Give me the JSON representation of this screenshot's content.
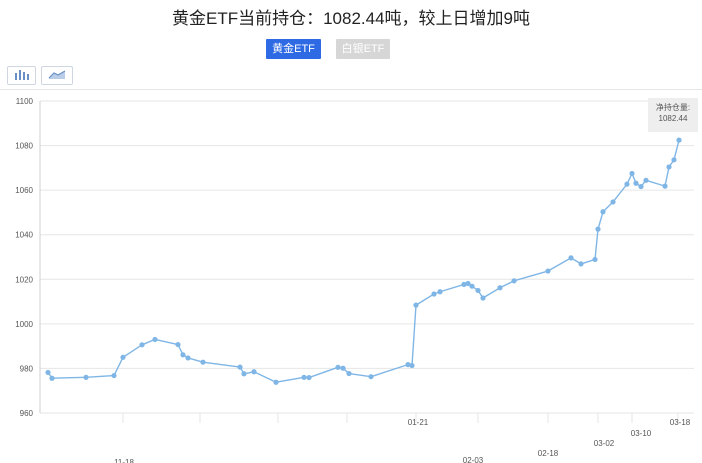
{
  "header": {
    "title": "黄金ETF当前持仓：1082.44吨，较上日增加9吨"
  },
  "tabs": [
    {
      "label": "黄金ETF",
      "active": true,
      "color": "#2d6ae3"
    },
    {
      "label": "白银ETF",
      "active": false,
      "color": "#d6d6d6"
    }
  ],
  "toolbar": {
    "bar_icon": "bar-chart-icon",
    "line_icon": "line-chart-icon"
  },
  "tooltip": {
    "label": "净持仓量:",
    "value": "1082.44"
  },
  "colors": {
    "line": "#7fb6e6",
    "grid": "#e6e6e6"
  },
  "chart_data": {
    "type": "line",
    "y_ticks": [
      "960",
      "980",
      "1000",
      "1020",
      "1040",
      "1060",
      "1080",
      "1100"
    ],
    "ylim": [
      960,
      1100
    ],
    "x_tick_labels": [
      "11-18",
      "01-21",
      "02-03",
      "02-18",
      "03-02",
      "03-10",
      "03-18"
    ],
    "series": [
      {
        "values": [
          978.2,
          975.6,
          976.0,
          976.8,
          985.0,
          990.6,
          993.0,
          990.7,
          986.1,
          984.7,
          982.8,
          980.6,
          977.6,
          978.5,
          973.8,
          976.0,
          975.9,
          980.5,
          980.1,
          977.7,
          976.3,
          981.7,
          981.3,
          1008.4,
          1013.4,
          1014.4,
          1017.7,
          1018.1,
          1016.9,
          1015.0,
          1011.6,
          1016.2,
          1019.3,
          1023.7,
          1029.6,
          1026.9,
          1028.9,
          1042.5,
          1050.3,
          1054.7,
          1062.7,
          1067.5,
          1063.1,
          1061.6,
          1064.4,
          1061.8,
          1070.4,
          1073.6,
          1082.44
        ]
      }
    ]
  }
}
